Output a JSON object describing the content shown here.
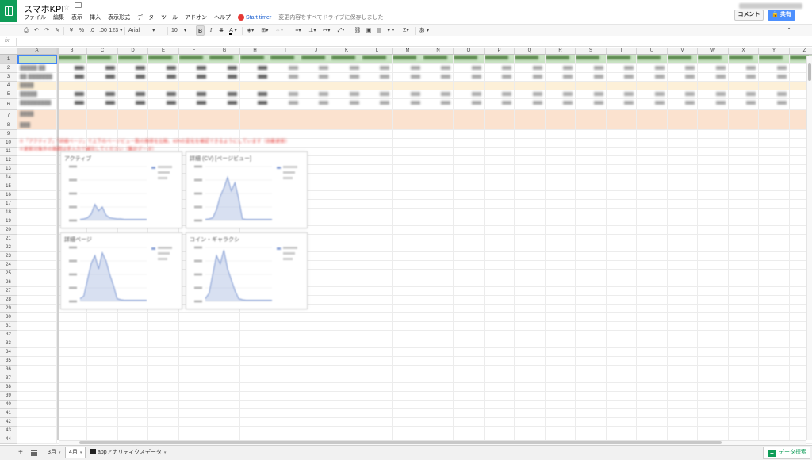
{
  "title": "スマホKPI",
  "menu": [
    "ファイル",
    "編集",
    "表示",
    "挿入",
    "表示形式",
    "データ",
    "ツール",
    "アドオン",
    "ヘルプ"
  ],
  "timer_label": "Start timer",
  "save_status": "変更内容をすべてドライブに保存しました",
  "buttons": {
    "comment": "コメント",
    "share": "共有"
  },
  "toolbar": {
    "currency": "¥",
    "percent": "%",
    "dec_less": ".0",
    "dec_more": ".00",
    "format_123": "123",
    "font": "Arial",
    "font_size": "10",
    "bold": "B",
    "italic": "I",
    "strike": "S",
    "text_color": "A",
    "input_tools": "あ"
  },
  "formula_label": "fx",
  "columns": [
    "A",
    "B",
    "C",
    "D",
    "E",
    "F",
    "G",
    "H",
    "I",
    "J",
    "K",
    "L",
    "M",
    "N",
    "O",
    "P",
    "Q",
    "R",
    "S",
    "T",
    "U",
    "V",
    "W",
    "X",
    "Y",
    "Z"
  ],
  "colors": {
    "accent_green": "#0f9d58",
    "share_blue": "#4d90fe",
    "header_row_green": "#c9e3c3",
    "row_yellow": "#fdf0d8",
    "row_peach": "#fbe2cf",
    "selection_blue": "#4285f4",
    "chart_blue": "#8fa6d8"
  },
  "sheet_tabs": [
    {
      "label": "3月",
      "active": false
    },
    {
      "label": "4月",
      "active": true
    },
    {
      "label": "appアナリティクスデータ",
      "active": false
    }
  ],
  "explore_label": "データ探索",
  "charts": [
    {
      "title": "アクティブ",
      "values": [
        0.02,
        0.03,
        0.05,
        0.12,
        0.3,
        0.18,
        0.25,
        0.1,
        0.05,
        0.04,
        0.03,
        0.03,
        0.02,
        0.02,
        0.02,
        0.02,
        0.02,
        0.02,
        0.02
      ]
    },
    {
      "title": "詳細 (CV) [ページビュー]",
      "values": [
        0.02,
        0.03,
        0.05,
        0.2,
        0.45,
        0.6,
        0.8,
        0.55,
        0.7,
        0.4,
        0.03,
        0.02,
        0.02,
        0.02,
        0.02,
        0.02,
        0.02,
        0.02,
        0.02
      ]
    },
    {
      "title": "詳細ページ",
      "values": [
        0.05,
        0.1,
        0.4,
        0.7,
        0.85,
        0.6,
        0.9,
        0.75,
        0.5,
        0.3,
        0.05,
        0.03,
        0.02,
        0.02,
        0.02,
        0.02,
        0.02,
        0.02,
        0.02
      ]
    },
    {
      "title": "コイン・ギャラクシ",
      "values": [
        0.05,
        0.15,
        0.5,
        0.85,
        0.7,
        0.95,
        0.6,
        0.4,
        0.2,
        0.05,
        0.03,
        0.02,
        0.02,
        0.02,
        0.02,
        0.02,
        0.02,
        0.02,
        0.02
      ]
    }
  ],
  "icons": [
    "star-icon",
    "folder-icon",
    "print-icon",
    "undo-icon",
    "redo-icon",
    "paint-format-icon",
    "fill-color-icon",
    "borders-icon",
    "merge-icon",
    "align-icon",
    "valign-icon",
    "wrap-icon",
    "rotate-icon",
    "link-icon",
    "comment-icon",
    "chart-icon",
    "filter-icon",
    "function-icon",
    "collapse-icon",
    "add-sheet-icon",
    "sheet-list-icon",
    "explore-icon"
  ]
}
